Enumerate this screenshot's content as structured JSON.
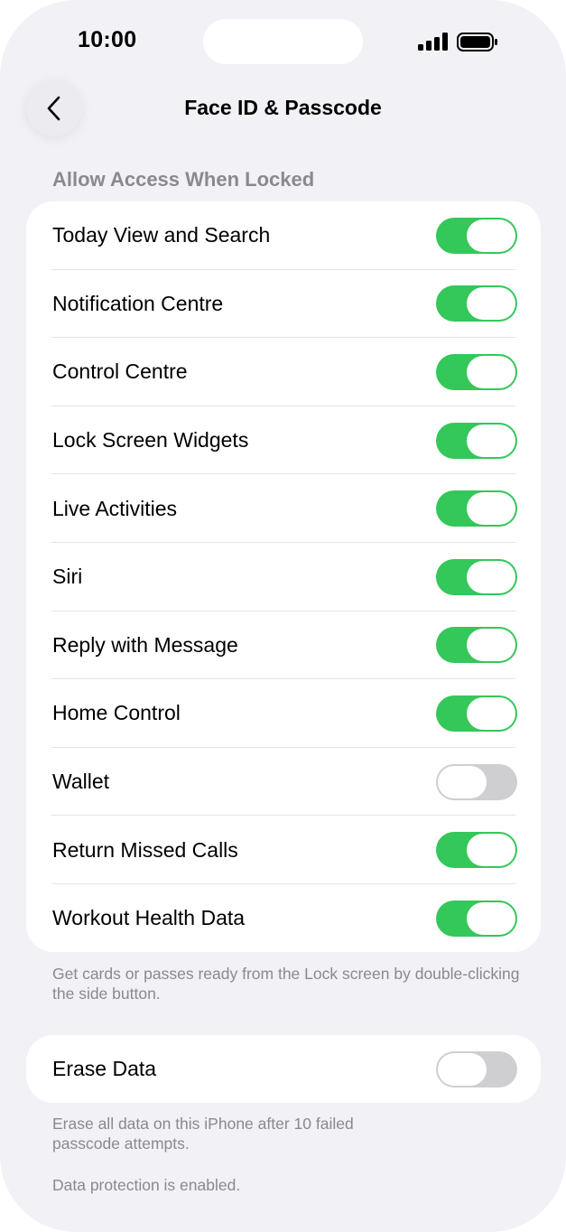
{
  "status": {
    "time": "10:00",
    "signal_icon": "cellular-signal-icon",
    "battery_icon": "battery-icon"
  },
  "nav": {
    "back_icon": "chevron-left-icon",
    "title": "Face ID & Passcode"
  },
  "section": {
    "header": "Allow Access When Locked",
    "items": [
      {
        "label": "Today View and Search",
        "on": true
      },
      {
        "label": "Notification Centre",
        "on": true
      },
      {
        "label": "Control Centre",
        "on": true
      },
      {
        "label": "Lock Screen Widgets",
        "on": true
      },
      {
        "label": "Live Activities",
        "on": true
      },
      {
        "label": "Siri",
        "on": true
      },
      {
        "label": "Reply with Message",
        "on": true
      },
      {
        "label": "Home Control",
        "on": true
      },
      {
        "label": "Wallet",
        "on": false
      },
      {
        "label": "Return Missed Calls",
        "on": true
      },
      {
        "label": "Workout Health Data",
        "on": true
      }
    ],
    "footnote": "Get cards or passes ready from the Lock screen by double-clicking the side button."
  },
  "erase": {
    "label": "Erase Data",
    "on": false,
    "footnote": "Erase all data on this iPhone after 10 failed passcode attempts.",
    "protection_note": "Data protection is enabled."
  },
  "colors": {
    "toggle_on": "#34c759",
    "toggle_off": "#cfcfd2",
    "background": "#f2f1f6",
    "secondary_text": "#8a8a8e"
  }
}
